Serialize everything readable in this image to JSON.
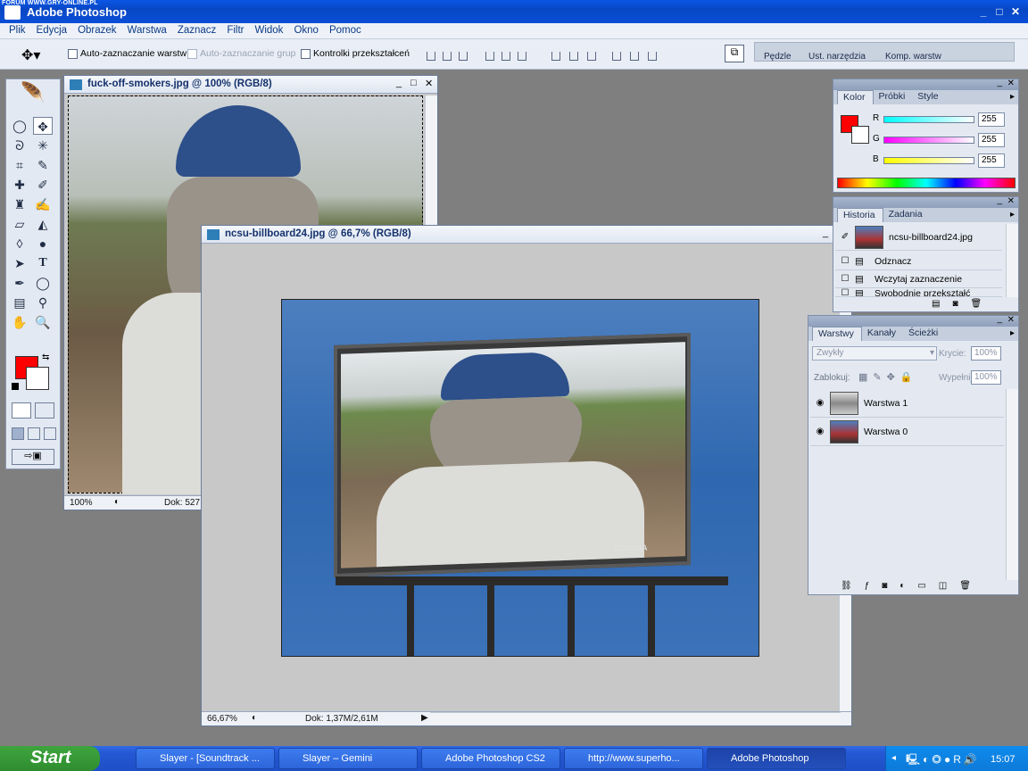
{
  "watermark": "FORUM WWW.GRY-ONLINE.PL",
  "app": {
    "title": "Adobe Photoshop"
  },
  "menu": [
    "Plik",
    "Edycja",
    "Obrazek",
    "Warstwa",
    "Zaznacz",
    "Filtr",
    "Widok",
    "Okno",
    "Pomoc"
  ],
  "options": {
    "auto_select_layer": "Auto-zaznaczanie warstw",
    "auto_select_group": "Auto-zaznaczanie grup",
    "transform_controls": "Kontrolki przekształceń"
  },
  "well_tabs": [
    "Pędzle",
    "Ust. narzędzia",
    "Komp. warstw"
  ],
  "doc1": {
    "title": "fuck-off-smokers.jpg @ 100% (RGB/8)",
    "zoom": "100%",
    "doc_info": "Dok: 527"
  },
  "doc2": {
    "title": "ncsu-billboard24.jpg @ 66,7% (RGB/8)",
    "zoom": "66,67%",
    "doc_info": "Dok: 1,37M/2,61M",
    "billboard_text": "CSOJUA"
  },
  "color_panel": {
    "tabs": [
      "Kolor",
      "Próbki",
      "Style"
    ],
    "channels": [
      {
        "label": "R",
        "value": "255"
      },
      {
        "label": "G",
        "value": "255"
      },
      {
        "label": "B",
        "value": "255"
      }
    ],
    "foreground": "#ff0000"
  },
  "history_panel": {
    "tabs": [
      "Historia",
      "Zadania"
    ],
    "snapshot": "ncsu-billboard24.jpg",
    "items": [
      "Odznacz",
      "Wczytaj zaznaczenie",
      "Swobodnie przekształć"
    ]
  },
  "layers_panel": {
    "tabs": [
      "Warstwy",
      "Kanały",
      "Ścieżki"
    ],
    "blend_mode": "Zwykły",
    "opacity_label": "Krycie:",
    "opacity": "100%",
    "lock_label": "Zablokuj:",
    "fill_label": "Wypełnij:",
    "fill": "100%",
    "layers": [
      "Warstwa 1",
      "Warstwa 0"
    ]
  },
  "taskbar": {
    "start": "Start",
    "tasks": [
      "Slayer - [Soundtrack ...",
      "Slayer – Gemini",
      "Adobe Photoshop CS2",
      "http://www.superho...",
      "Adobe Photoshop"
    ],
    "clock": "15:07"
  }
}
